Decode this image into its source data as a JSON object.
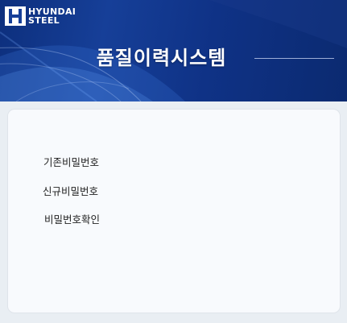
{
  "brand": {
    "line1": "HYUNDAI",
    "line2": "STEEL"
  },
  "header": {
    "title": "품질이력시스템"
  },
  "form": {
    "fields": [
      {
        "label": "기존비밀번호"
      },
      {
        "label": "신규비밀번호"
      },
      {
        "label": "비밀번호확인"
      }
    ]
  },
  "colors": {
    "header_bg": "#163f98",
    "panel_bg": "#f8fafd",
    "page_bg": "#e9eef3"
  }
}
